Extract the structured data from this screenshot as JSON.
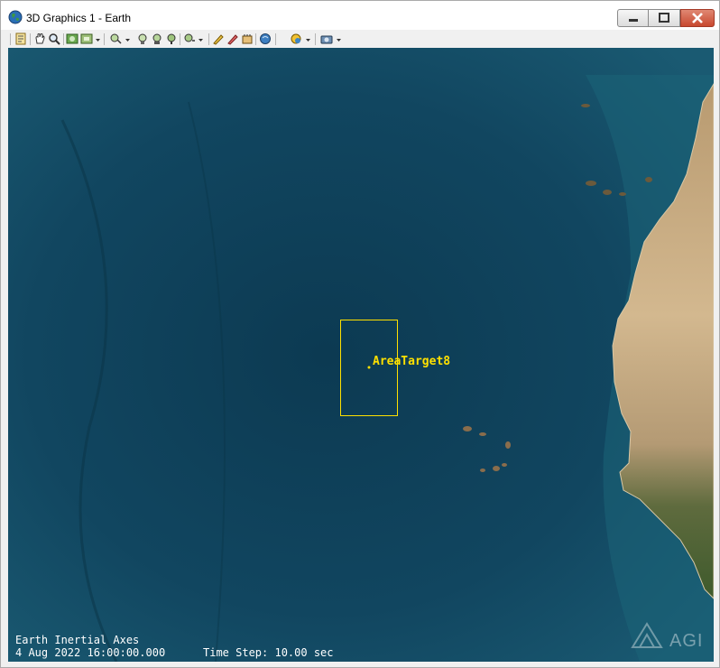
{
  "window": {
    "title": "3D Graphics 1 - Earth",
    "app_icon": "globe-icon"
  },
  "controls": {
    "minimize_icon": "minimize-icon",
    "maximize_icon": "maximize-icon",
    "close_icon": "close-icon"
  },
  "toolbar": {
    "items": [
      {
        "icon": "properties-icon"
      },
      {
        "icon": "pan-hand-icon"
      },
      {
        "icon": "zoom-icon"
      },
      {
        "icon": "home-view-icon"
      },
      {
        "icon": "snapshot-icon"
      },
      {
        "icon": "view-from-to-icon"
      },
      {
        "icon": "orbit-icon"
      },
      {
        "icon": "object-view-icon"
      },
      {
        "icon": "camera-icon"
      },
      {
        "icon": "measure-icon"
      },
      {
        "icon": "draw-icon"
      },
      {
        "icon": "terrain-icon"
      },
      {
        "icon": "globe-manager-icon"
      },
      {
        "icon": "overlay-icon"
      },
      {
        "icon": "record-movie-icon"
      }
    ]
  },
  "scene": {
    "area_target_label": "AreaTarget8",
    "frame_label": "Earth Inertial Axes",
    "epoch": "4 Aug 2022 16:00:00.000",
    "time_step": "Time Step: 10.00 sec",
    "watermark": "AGI",
    "label_color": "#ffe000",
    "ocean_color": "#0f3f54",
    "land_color": "#c8ad86"
  }
}
